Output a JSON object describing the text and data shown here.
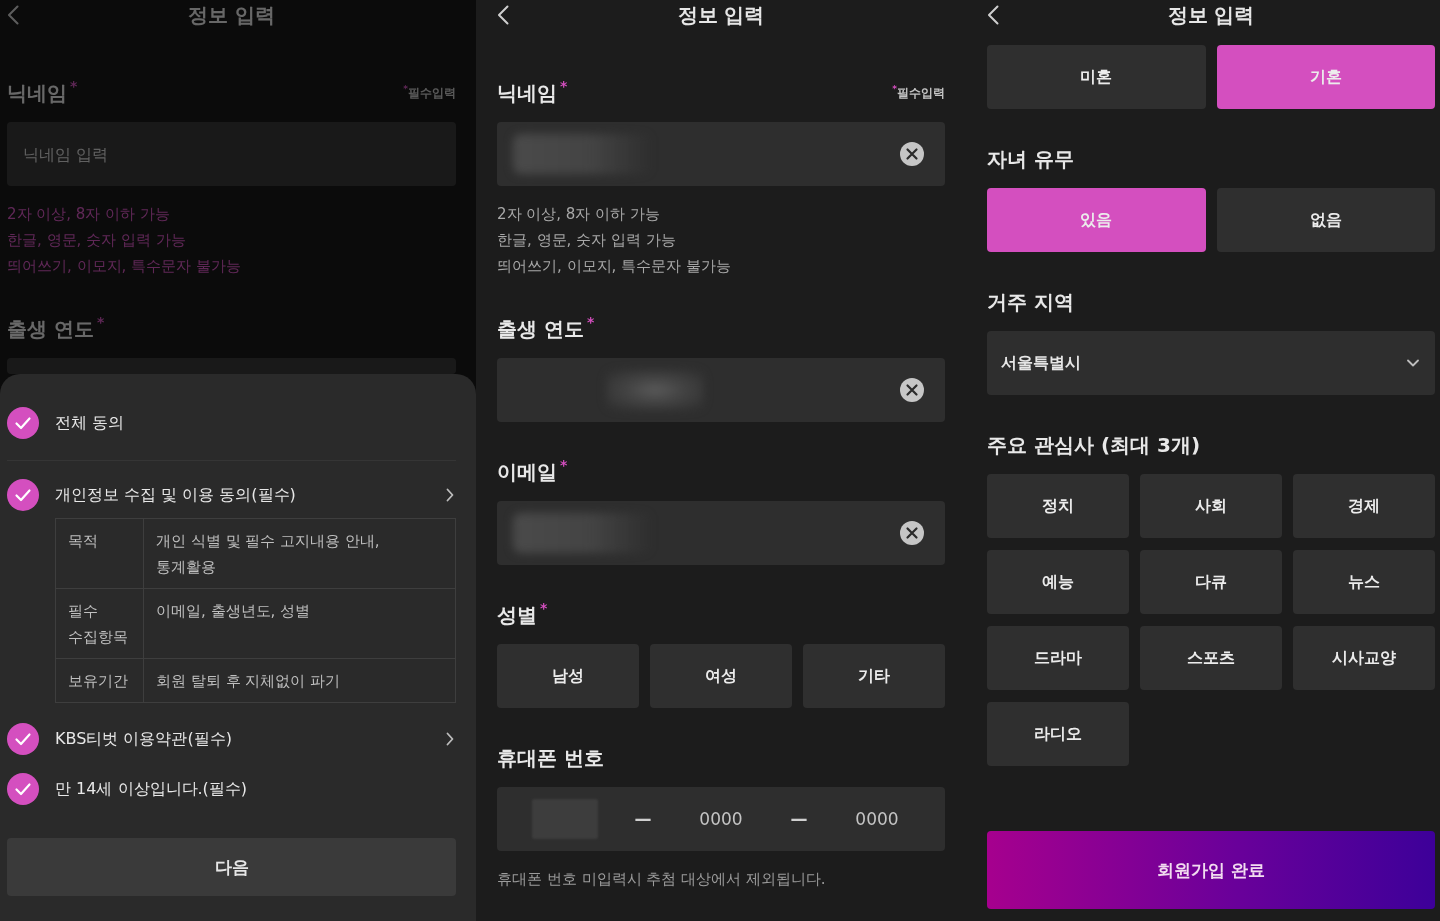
{
  "screens": [
    {
      "title": "정보 입력",
      "dimmed": true,
      "scrolled": false,
      "sections": [
        {
          "kind": "text",
          "label": "닉네임",
          "required_mark": "*",
          "aside": {
            "mark": "*",
            "text": "필수입력"
          },
          "placeholder": "닉네임 입력",
          "redacted": false,
          "clearable": false,
          "hints": [
            "2자 이상, 8자 이하 가능",
            "한글, 영문, 숫자 입력 가능",
            "띄어쓰기, 이모지, 특수문자 불가능"
          ],
          "hint_error": true
        },
        {
          "kind": "year",
          "label": "출생 연도",
          "required_mark": "*",
          "redacted": false,
          "clearable": false
        }
      ],
      "sheet": {
        "items": [
          {
            "label": "전체 동의",
            "checked": true,
            "arrow": false,
            "divider": true
          },
          {
            "label": "개인정보 수집 및 이용 동의(필수)",
            "checked": true,
            "arrow": true,
            "divider": false,
            "table": [
              {
                "term": "목적",
                "detail": "개인 식별 및 필수 고지내용 안내,\n통계활용"
              },
              {
                "term": "필수\n수집항목",
                "detail": "이메일, 출생년도, 성별"
              },
              {
                "term": "보유기간",
                "detail": "회원 탈퇴 후 지체없이 파기"
              }
            ]
          },
          {
            "label": "KBS티벗 이용약관(필수)",
            "checked": true,
            "arrow": true,
            "divider": false
          },
          {
            "label": "만 14세 이상입니다.(필수)",
            "checked": true,
            "arrow": false,
            "divider": false
          }
        ],
        "button": "다음"
      }
    },
    {
      "title": "정보 입력",
      "dimmed": false,
      "scrolled": false,
      "sections": [
        {
          "kind": "text",
          "label": "닉네임",
          "required_mark": "*",
          "aside": {
            "mark": "*",
            "text": "필수입력"
          },
          "redacted": true,
          "clearable": true,
          "hints": [
            "2자 이상, 8자 이하 가능",
            "한글, 영문, 숫자 입력 가능",
            "띄어쓰기, 이모지, 특수문자 불가능"
          ],
          "hint_error": false
        },
        {
          "kind": "year",
          "label": "출생 연도",
          "required_mark": "*",
          "redacted": true,
          "clearable": true
        },
        {
          "kind": "text",
          "label": "이메일",
          "required_mark": "*",
          "redacted": true,
          "clearable": true
        },
        {
          "kind": "choice",
          "label": "성별",
          "required_mark": "*",
          "options": [
            {
              "label": "남성",
              "selected": false
            },
            {
              "label": "여성",
              "selected": false
            },
            {
              "label": "기타",
              "selected": false
            }
          ]
        },
        {
          "kind": "phone",
          "label": "휴대폰 번호",
          "parts": [
            {
              "kind": "segment",
              "redacted": true
            },
            {
              "kind": "separator",
              "text": "—"
            },
            {
              "kind": "segment",
              "redacted": false,
              "placeholder": "0000"
            },
            {
              "kind": "separator",
              "text": "—"
            },
            {
              "kind": "segment",
              "redacted": false,
              "placeholder": "0000"
            }
          ],
          "note": "휴대폰 번호 미입력시 추첨 대상에서 제외됩니다."
        }
      ]
    },
    {
      "title": "정보 입력",
      "dimmed": false,
      "scrolled": true,
      "sections": [
        {
          "kind": "choice",
          "options": [
            {
              "label": "미혼",
              "selected": false
            },
            {
              "label": "기혼",
              "selected": true
            }
          ]
        },
        {
          "kind": "choice",
          "label": "자녀 유무",
          "options": [
            {
              "label": "있음",
              "selected": true
            },
            {
              "label": "없음",
              "selected": false
            }
          ]
        },
        {
          "kind": "select",
          "label": "거주 지역",
          "value": "서울특별시"
        },
        {
          "kind": "choice",
          "label": "주요 관심사 (최대 3개)",
          "options": [
            {
              "label": "정치",
              "selected": false
            },
            {
              "label": "사회",
              "selected": false
            },
            {
              "label": "경제",
              "selected": false
            },
            {
              "label": "예능",
              "selected": false
            },
            {
              "label": "다큐",
              "selected": false
            },
            {
              "label": "뉴스",
              "selected": false
            },
            {
              "label": "드라마",
              "selected": false
            },
            {
              "label": "스포츠",
              "selected": false
            },
            {
              "label": "시사교양",
              "selected": false
            },
            {
              "label": "라디오",
              "selected": false
            }
          ]
        }
      ],
      "submit": "회원가입 완료"
    }
  ]
}
